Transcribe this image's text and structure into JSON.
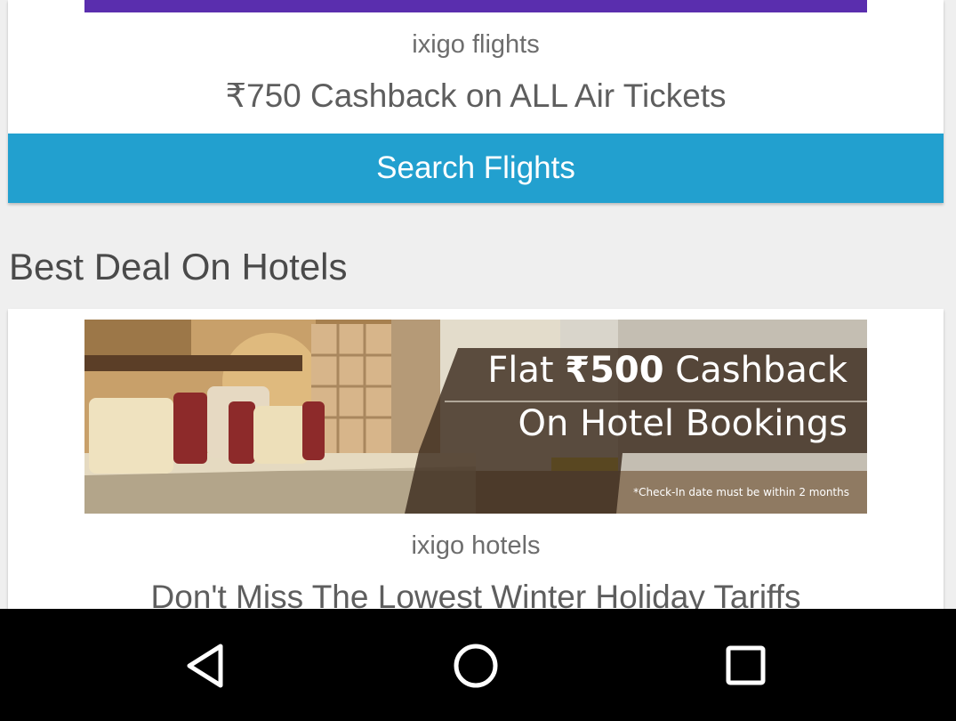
{
  "flights": {
    "provider": "ixigo flights",
    "offer": "₹750 Cashback on ALL Air Tickets",
    "cta_label": "Search Flights"
  },
  "hotels_section": {
    "title": "Best Deal On Hotels",
    "banner": {
      "line1_prefix": "Flat ",
      "line1_amount": "₹500",
      "line1_suffix": " Cashback",
      "line2": "On Hotel Bookings",
      "footnote": "*Check-In date must be within 2 months"
    },
    "provider": "ixigo hotels",
    "offer": "Don't Miss The Lowest Winter Holiday Tariffs"
  },
  "nav": {
    "back_icon": "back-triangle-icon",
    "home_icon": "home-circle-icon",
    "recents_icon": "recents-square-icon"
  },
  "colors": {
    "cta": "#22a0cf",
    "banner_strip": "#5a2eae",
    "background": "#efefef"
  }
}
